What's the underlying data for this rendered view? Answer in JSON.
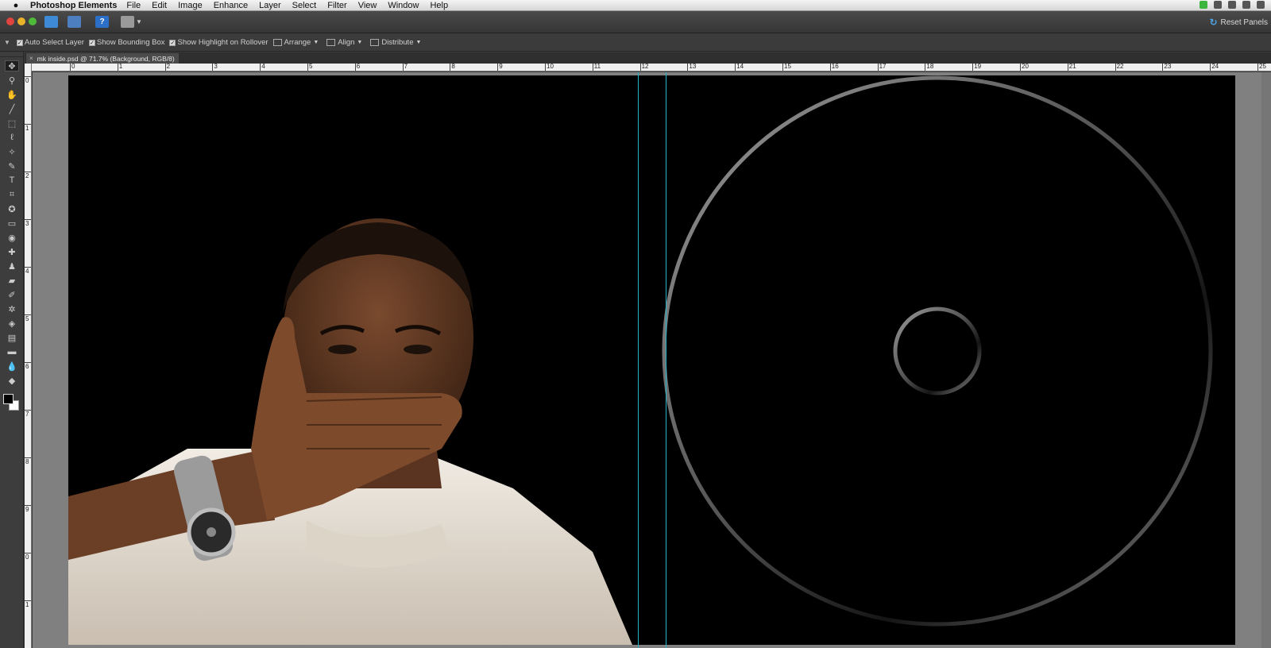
{
  "menubar": {
    "apple": "",
    "app_name": "Photoshop Elements",
    "items": [
      "File",
      "Edit",
      "Image",
      "Enhance",
      "Layer",
      "Select",
      "Filter",
      "View",
      "Window",
      "Help"
    ]
  },
  "appbar": {
    "help_label": "?",
    "reset_panels": "Reset Panels"
  },
  "options": {
    "auto_select_layer": "Auto Select Layer",
    "show_bounding_box": "Show Bounding Box",
    "show_highlight": "Show Highlight on Rollover",
    "arrange": "Arrange",
    "align": "Align",
    "distribute": "Distribute"
  },
  "document": {
    "tab_title": "mk inside.psd @ 71.7% (Background, RGB/8)",
    "close": "×"
  },
  "ruler": {
    "top": [
      "0",
      "1",
      "2",
      "3",
      "4",
      "5",
      "6",
      "7",
      "8",
      "9",
      "10",
      "11",
      "12",
      "13",
      "14",
      "15",
      "16",
      "17",
      "18",
      "19",
      "20",
      "21",
      "22",
      "23",
      "24",
      "25"
    ],
    "left": [
      "0",
      "1",
      "2",
      "3",
      "4",
      "5",
      "6",
      "7",
      "8",
      "9",
      "0",
      "1"
    ]
  },
  "tools": [
    {
      "name": "move-tool-icon",
      "glyph": "✥"
    },
    {
      "name": "zoom-tool-icon",
      "glyph": "⚲"
    },
    {
      "name": "hand-tool-icon",
      "glyph": "✋"
    },
    {
      "name": "eyedropper-tool-icon",
      "glyph": "╱"
    },
    {
      "name": "marquee-tool-icon",
      "glyph": "⬚"
    },
    {
      "name": "lasso-tool-icon",
      "glyph": "ℓ"
    },
    {
      "name": "magic-wand-tool-icon",
      "glyph": "✧"
    },
    {
      "name": "quick-selection-tool-icon",
      "glyph": "✎"
    },
    {
      "name": "type-tool-icon",
      "glyph": "T"
    },
    {
      "name": "crop-tool-icon",
      "glyph": "⌗"
    },
    {
      "name": "cookie-cutter-tool-icon",
      "glyph": "✪"
    },
    {
      "name": "straighten-tool-icon",
      "glyph": "▭"
    },
    {
      "name": "red-eye-tool-icon",
      "glyph": "◉"
    },
    {
      "name": "healing-brush-tool-icon",
      "glyph": "✚"
    },
    {
      "name": "clone-stamp-tool-icon",
      "glyph": "♟"
    },
    {
      "name": "eraser-tool-icon",
      "glyph": "▰"
    },
    {
      "name": "brush-tool-icon",
      "glyph": "✐"
    },
    {
      "name": "smart-brush-tool-icon",
      "glyph": "✲"
    },
    {
      "name": "paint-bucket-tool-icon",
      "glyph": "◈"
    },
    {
      "name": "gradient-tool-icon",
      "glyph": "▤"
    },
    {
      "name": "shape-tool-icon",
      "glyph": "▬"
    },
    {
      "name": "blur-tool-icon",
      "glyph": "💧"
    },
    {
      "name": "sponge-tool-icon",
      "glyph": "◆"
    }
  ],
  "colors": {
    "guide": "#24b3c9",
    "canvas": "#000000",
    "disc_ring": "#7a7a7a"
  }
}
